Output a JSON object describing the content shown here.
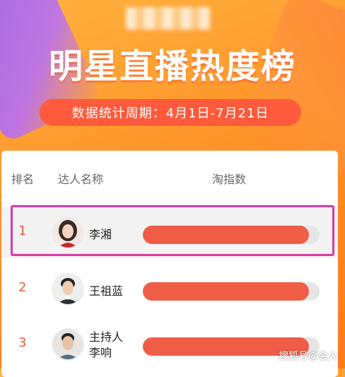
{
  "title": "明星直播热度榜",
  "period": "数据统计周期：4月1日-7月21日",
  "table": {
    "headers": {
      "rank": "排名",
      "name": "达人名称",
      "index": "淘指数"
    },
    "rows": [
      {
        "rank": "1",
        "name": "李湘",
        "bar_fraction": 0.94,
        "avatar": "female-portrait"
      },
      {
        "rank": "2",
        "name": "王祖蓝",
        "bar_fraction": 0.94,
        "avatar": "male-portrait"
      },
      {
        "rank": "3",
        "name_line1": "主持人",
        "name_line2": "李响",
        "bar_fraction": 0.94,
        "avatar": "male-portrait"
      }
    ]
  },
  "watermark": "搜狐号@会火",
  "colors": {
    "accent": "#ef5d47",
    "highlight_border": "#d83aa0",
    "pill": "#ff5a3c"
  }
}
